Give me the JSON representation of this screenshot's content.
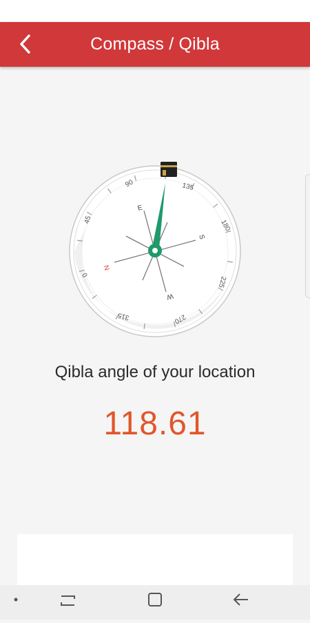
{
  "app_bar": {
    "title": "Compass / Qibla",
    "back_icon": "chevron-left-icon",
    "color": "#d0383a"
  },
  "compass": {
    "needle_color": "#1f9a6a",
    "north_color": "#e53935",
    "kaaba_icon": "kaaba-icon",
    "dial_labels": {
      "n": "N",
      "e": "E",
      "s": "S",
      "w": "W",
      "deg_0": "0",
      "deg_45": "45",
      "deg_90": "90",
      "deg_135": "135",
      "deg_180": "180",
      "deg_225": "225",
      "deg_270": "270",
      "deg_315": "315"
    }
  },
  "qibla": {
    "label": "Qibla angle of your location",
    "value": "118.61",
    "value_color": "#e1562a"
  },
  "nav_bar": {
    "dot_icon": "dot-icon",
    "recents_icon": "recent-apps-icon",
    "home_icon": "home-square-icon",
    "back_icon": "back-arrow-icon"
  }
}
